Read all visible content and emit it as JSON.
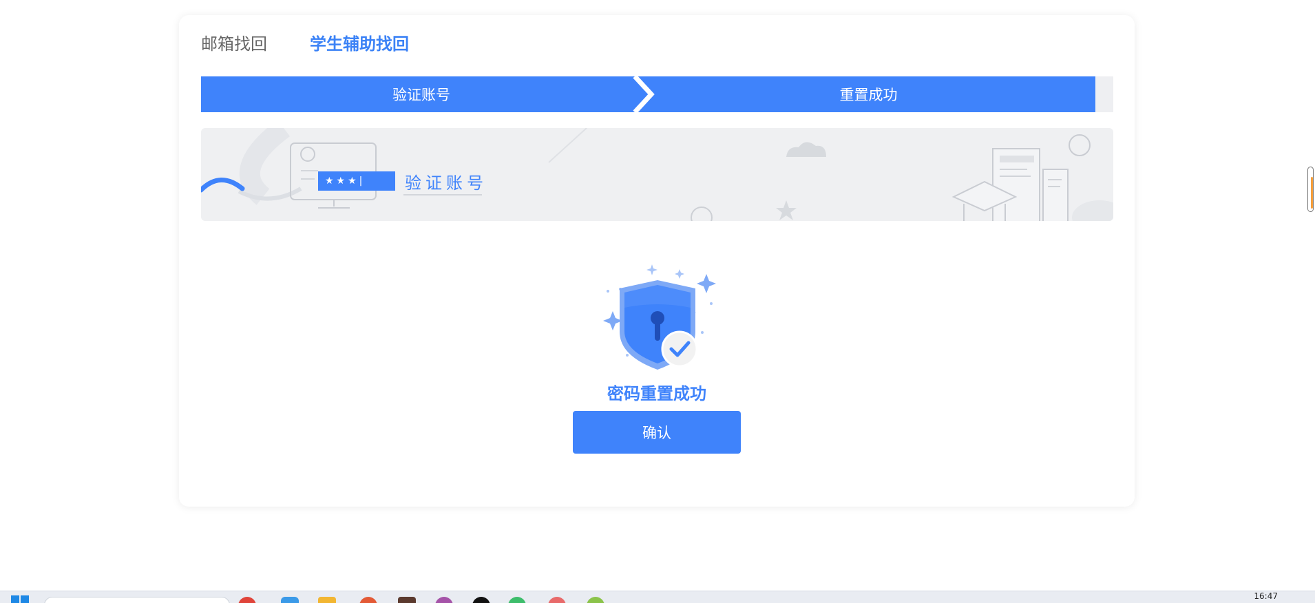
{
  "tabs": [
    {
      "label": "邮箱找回",
      "active": false
    },
    {
      "label": "学生辅助找回",
      "active": true
    }
  ],
  "steps": [
    {
      "label": "验证账号"
    },
    {
      "label": "重置成功"
    }
  ],
  "banner": {
    "title": "验证账号",
    "password_mask": "★★★|"
  },
  "result": {
    "message": "密码重置成功",
    "confirm_label": "确认"
  },
  "taskbar": {
    "clock": "16:47"
  },
  "colors": {
    "accent": "#3f83fb",
    "inactive_tab": "#666666",
    "banner_bg": "#eff0f2"
  },
  "icons": [
    "shield-lock-icon",
    "check-icon",
    "sparkle-icon",
    "windows-start-icon"
  ]
}
